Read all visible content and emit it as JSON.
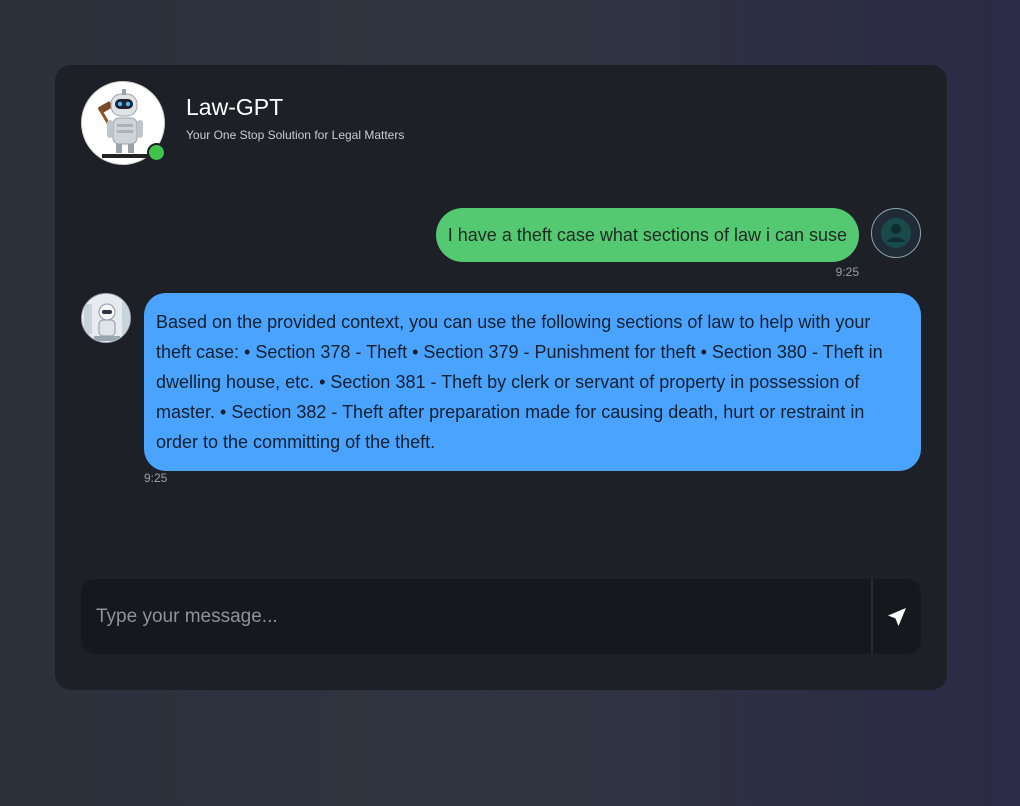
{
  "header": {
    "title": "Law-GPT",
    "subtitle": "Your One Stop Solution for Legal Matters",
    "status": "online",
    "logo_icon": "robot-judge-logo"
  },
  "messages": [
    {
      "sender": "user",
      "text": "I have a theft case what sections of law i can suse",
      "time": "9:25",
      "avatar_icon": "user-icon"
    },
    {
      "sender": "bot",
      "text": "Based on the provided context, you can use the following sections of law to help with your theft case: • Section 378 - Theft • Section 379 - Punishment for theft • Section 380 - Theft in dwelling house, etc. • Section 381 - Theft by clerk or servant of property in possession of master. • Section 382 - Theft after preparation made for causing death, hurt or restraint in order to the committing of the theft.",
      "time": "9:25",
      "avatar_icon": "robot-avatar"
    }
  ],
  "composer": {
    "placeholder": "Type your message...",
    "value": "",
    "send_icon": "send-arrow-icon"
  },
  "colors": {
    "user_bubble": "#55c872",
    "bot_bubble": "#4aa3ff",
    "card": "#1d2027",
    "online": "#41c34e"
  }
}
